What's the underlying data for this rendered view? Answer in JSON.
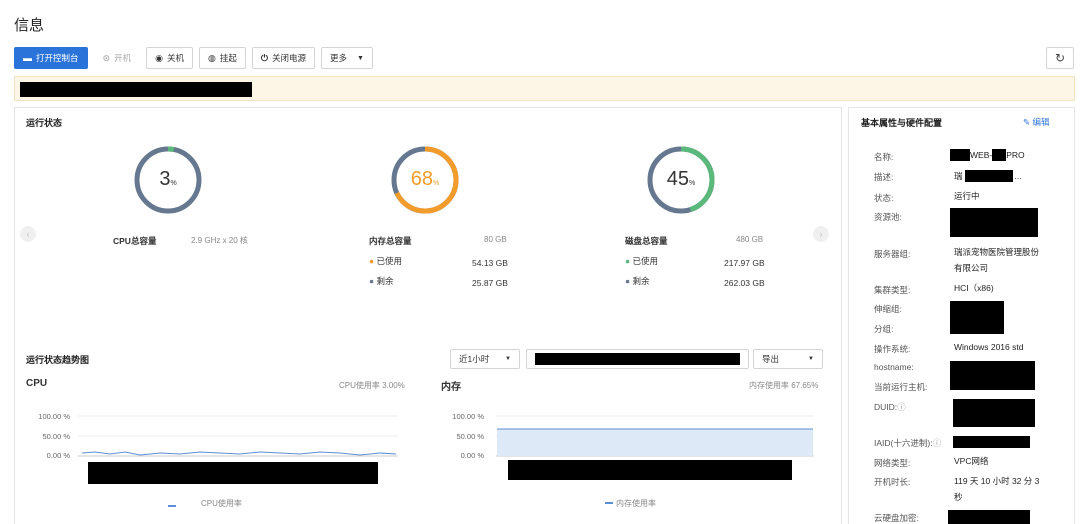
{
  "page_title": "信息",
  "toolbar": {
    "open_console": "打开控制台",
    "power_on": "开机",
    "shutdown": "关机",
    "suspend": "挂起",
    "power_off": "关闭电源",
    "more": "更多"
  },
  "runtime": {
    "title": "运行状态",
    "cpu": {
      "value": "3",
      "unit": "%",
      "percent": 3,
      "label": "CPU总容量",
      "capacity": "2.9 GHz x 20 核",
      "color": "#5ab87a"
    },
    "memory": {
      "value": "68",
      "unit": "%",
      "percent": 68,
      "label": "内存总容量",
      "capacity": "80 GB",
      "used_label": "已使用",
      "used": "54.13 GB",
      "free_label": "剩余",
      "free": "25.87 GB",
      "color": "#f39c2b"
    },
    "disk": {
      "value": "45",
      "unit": "%",
      "percent": 45,
      "label": "磁盘总容量",
      "capacity": "480 GB",
      "used_label": "已使用",
      "used": "217.97 GB",
      "free_label": "剩余",
      "free": "262.03 GB",
      "color": "#5ab87a"
    }
  },
  "trend": {
    "title": "运行状态趋势图",
    "range": "近1小时",
    "export": "导出",
    "cpu_title": "CPU",
    "cpu_usage": "CPU使用率 3.00%",
    "cpu_legend": "CPU使用率",
    "mem_title": "内存",
    "mem_usage": "内存使用率 67.65%",
    "mem_legend": "内存使用率",
    "ticks": [
      "100.00 %",
      "50.00 %",
      "0.00 %"
    ]
  },
  "props": {
    "title": "基本属性与硬件配置",
    "edit": "编辑",
    "rows": {
      "name_label": "名称:",
      "name_value": "WEB-",
      "name_value2": "PRO",
      "desc_label": "描述:",
      "desc_value": "瑞",
      "desc_tail": "...",
      "status_label": "状态:",
      "status_value": "运行中",
      "pool_label": "资源池:",
      "server_label": "服务器组:",
      "server_value": "瑞派宠物医院管理股份有限公司",
      "cluster_label": "集群类型:",
      "cluster_value": "HCI（x86)",
      "scale_label": "伸缩组:",
      "group_label": "分组:",
      "os_label": "操作系统:",
      "os_value": "Windows 2016 std",
      "hostname_label": "hostname:",
      "host_label": "当前运行主机:",
      "duid_label": "DUID:",
      "iaid_label": "IAID(十六进制):",
      "net_label": "网络类型:",
      "net_value": "VPC网络",
      "uptime_label": "开机时长:",
      "uptime_value": "119 天 10 小时 32 分 3 秒",
      "disk_enc_label": "云硬盘加密:"
    }
  }
}
